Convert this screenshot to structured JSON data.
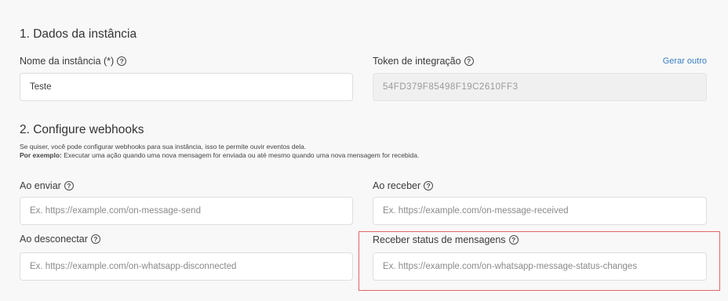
{
  "section1": {
    "title": "1. Dados da instância",
    "instance_name": {
      "label": "Nome da instância (*)",
      "value": "Teste"
    },
    "token": {
      "label": "Token de integração",
      "value": "54FD379F85498F19C2610FF3",
      "regenerate_link": "Gerar outro"
    }
  },
  "section2": {
    "title": "2. Configure webhooks",
    "description_line1": "Se quiser, você pode configurar webhooks para sua instância, isso te permite ouvir eventos dela.",
    "description_bold": "Por exemplo:",
    "description_line2": " Executar uma ação quando uma nova mensagem for enviada ou até mesmo quando uma nova mensagem for recebida.",
    "on_send": {
      "label": "Ao enviar",
      "placeholder": "Ex. https://example.com/on-message-send"
    },
    "on_receive": {
      "label": "Ao receber",
      "placeholder": "Ex. https://example.com/on-message-received"
    },
    "on_disconnect": {
      "label": "Ao desconectar",
      "placeholder": "Ex. https://example.com/on-whatsapp-disconnected"
    },
    "message_status": {
      "label": "Receber status de mensagens",
      "placeholder": "Ex. https://example.com/on-whatsapp-message-status-changes"
    }
  },
  "help_icon_glyph": "?",
  "colors": {
    "link": "#3b7fc4",
    "highlight_border": "#e06666",
    "background": "#f8f8f8"
  }
}
